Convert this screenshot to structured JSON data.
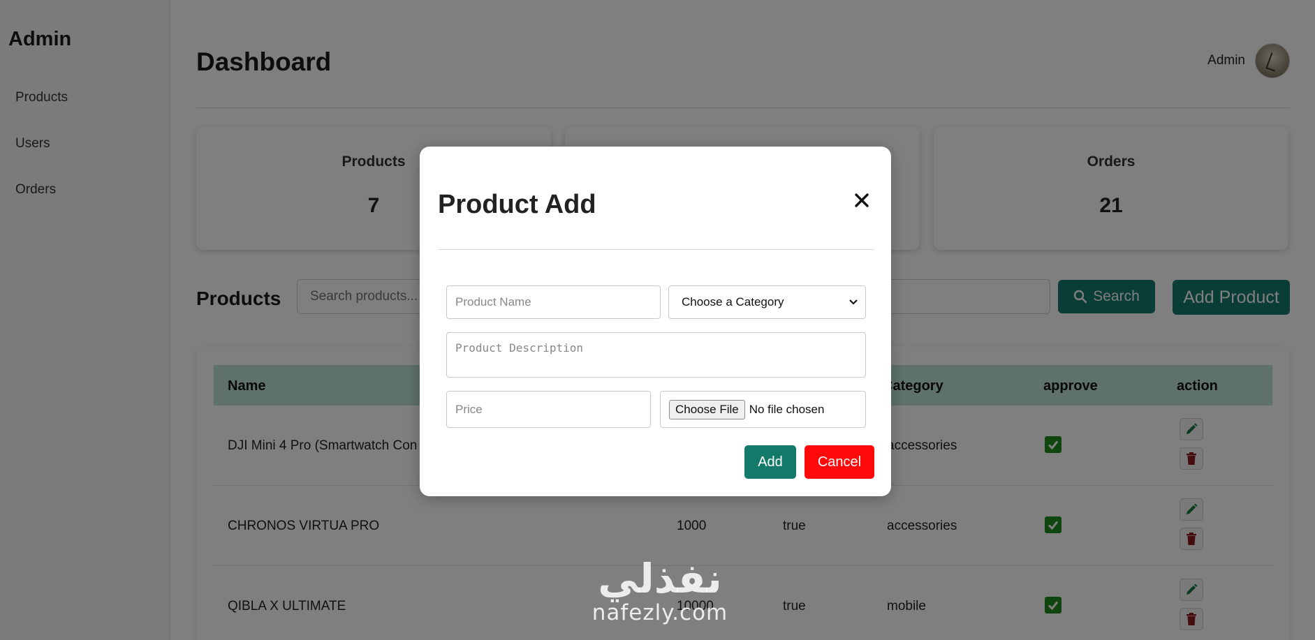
{
  "sidebar": {
    "brand": "Admin",
    "items": [
      {
        "label": "Products"
      },
      {
        "label": "Users"
      },
      {
        "label": "Orders"
      }
    ]
  },
  "header": {
    "title": "Dashboard",
    "user_name": "Admin"
  },
  "stats": [
    {
      "label": "Products",
      "value": "7"
    },
    {
      "label": "",
      "value": ""
    },
    {
      "label": "Orders",
      "value": "21"
    }
  ],
  "products_section": {
    "title": "Products",
    "search_placeholder": "Search products...",
    "search_label": "Search",
    "add_label": "Add Product"
  },
  "table": {
    "columns": [
      "Name",
      "Category",
      "approve",
      "action"
    ],
    "rows": [
      {
        "name": "DJI Mini 4 Pro (Smartwatch Con",
        "price": "",
        "status": "",
        "category": "accessories",
        "approved": true
      },
      {
        "name": "CHRONOS VIRTUA PRO",
        "price": "1000",
        "status": "true",
        "category": "accessories",
        "approved": true
      },
      {
        "name": "QIBLA X ULTIMATE",
        "price": "10000",
        "status": "true",
        "category": "mobile",
        "approved": true
      }
    ]
  },
  "modal": {
    "title": "Product Add",
    "name_placeholder": "Product Name",
    "category_selected": "Choose a Category",
    "description_placeholder": "Product Description",
    "price_placeholder": "Price",
    "file_button": "Choose File",
    "file_status": "No file chosen",
    "add_label": "Add",
    "cancel_label": "Cancel"
  },
  "watermark": {
    "arabic": "نفذلي",
    "latin": "nafezly.com"
  },
  "colors": {
    "accent": "#137a6a",
    "table_header": "#bfe3d8",
    "danger": "#ff0a0a",
    "approve_check": "#1e8a1e",
    "delete_icon": "#8b1a1a"
  },
  "icons": [
    "close-icon",
    "search-icon",
    "edit-icon",
    "delete-icon",
    "check-icon",
    "chevron-down-icon"
  ]
}
